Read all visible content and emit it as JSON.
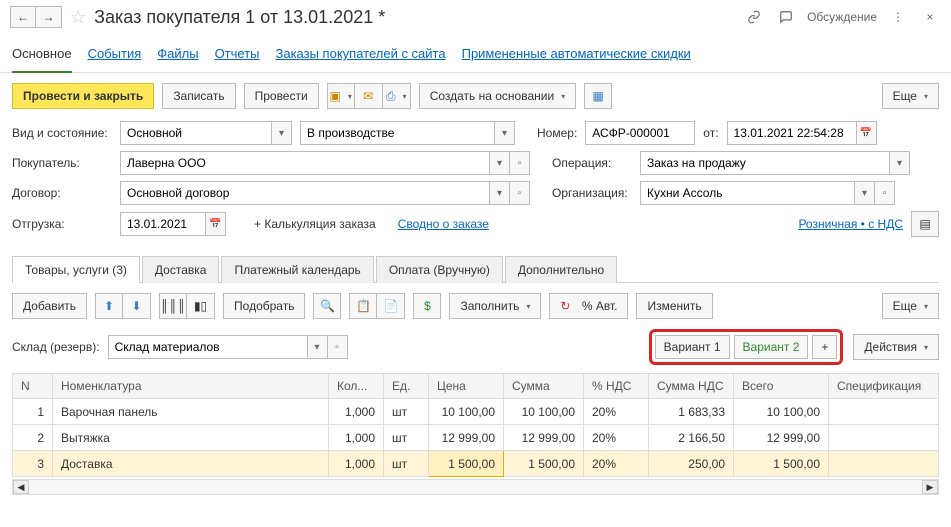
{
  "header": {
    "title": "Заказ покупателя 1 от 13.01.2021 *",
    "discuss": "Обсуждение"
  },
  "nav": {
    "main": "Основное",
    "events": "События",
    "files": "Файлы",
    "reports": "Отчеты",
    "site_orders": "Заказы покупателей с сайта",
    "auto_discounts": "Примененные автоматические скидки"
  },
  "toolbar": {
    "post_close": "Провести и закрыть",
    "write": "Записать",
    "post": "Провести",
    "create_based": "Создать на основании",
    "more": "Еще"
  },
  "fields": {
    "type_state_lbl": "Вид и состояние:",
    "type_val": "Основной",
    "state_val": "В производстве",
    "number_lbl": "Номер:",
    "number_val": "АСФР-000001",
    "from_lbl": "от:",
    "date_val": "13.01.2021 22:54:28",
    "buyer_lbl": "Покупатель:",
    "buyer_val": "Лаверна ООО",
    "operation_lbl": "Операция:",
    "operation_val": "Заказ на продажу",
    "contract_lbl": "Договор:",
    "contract_val": "Основной договор",
    "org_lbl": "Организация:",
    "org_val": "Кухни Ассоль",
    "ship_lbl": "Отгрузка:",
    "ship_val": "13.01.2021",
    "calc_order": "+ Калькуляция заказа",
    "summary": "Сводно о заказе",
    "retail_vat": "Розничная • с НДС"
  },
  "docTabs": {
    "goods": "Товары, услуги (3)",
    "delivery": "Доставка",
    "pay_cal": "Платежный календарь",
    "payment": "Оплата (Вручную)",
    "extra": "Дополнительно"
  },
  "subtoolbar": {
    "add": "Добавить",
    "select": "Подобрать",
    "fill": "Заполнить",
    "pct_auto": "% Авт.",
    "change": "Изменить",
    "more": "Еще"
  },
  "warehouse": {
    "lbl": "Склад (резерв):",
    "val": "Склад материалов",
    "variant1": "Вариант 1",
    "variant2": "Вариант 2",
    "add": "+",
    "actions": "Действия"
  },
  "columns": {
    "n": "N",
    "item": "Номенклатура",
    "qty": "Кол...",
    "unit": "Ед.",
    "price": "Цена",
    "sum": "Сумма",
    "vat_pct": "% НДС",
    "vat_sum": "Сумма НДС",
    "total": "Всего",
    "spec": "Спецификация"
  },
  "rows": [
    {
      "n": "1",
      "item": "Варочная панель",
      "qty": "1,000",
      "unit": "шт",
      "price": "10 100,00",
      "sum": "10 100,00",
      "vat": "20%",
      "vat_sum": "1 683,33",
      "total": "10 100,00"
    },
    {
      "n": "2",
      "item": "Вытяжка",
      "qty": "1,000",
      "unit": "шт",
      "price": "12 999,00",
      "sum": "12 999,00",
      "vat": "20%",
      "vat_sum": "2 166,50",
      "total": "12 999,00"
    },
    {
      "n": "3",
      "item": "Доставка",
      "qty": "1,000",
      "unit": "шт",
      "price": "1 500,00",
      "sum": "1 500,00",
      "vat": "20%",
      "vat_sum": "250,00",
      "total": "1 500,00"
    }
  ]
}
